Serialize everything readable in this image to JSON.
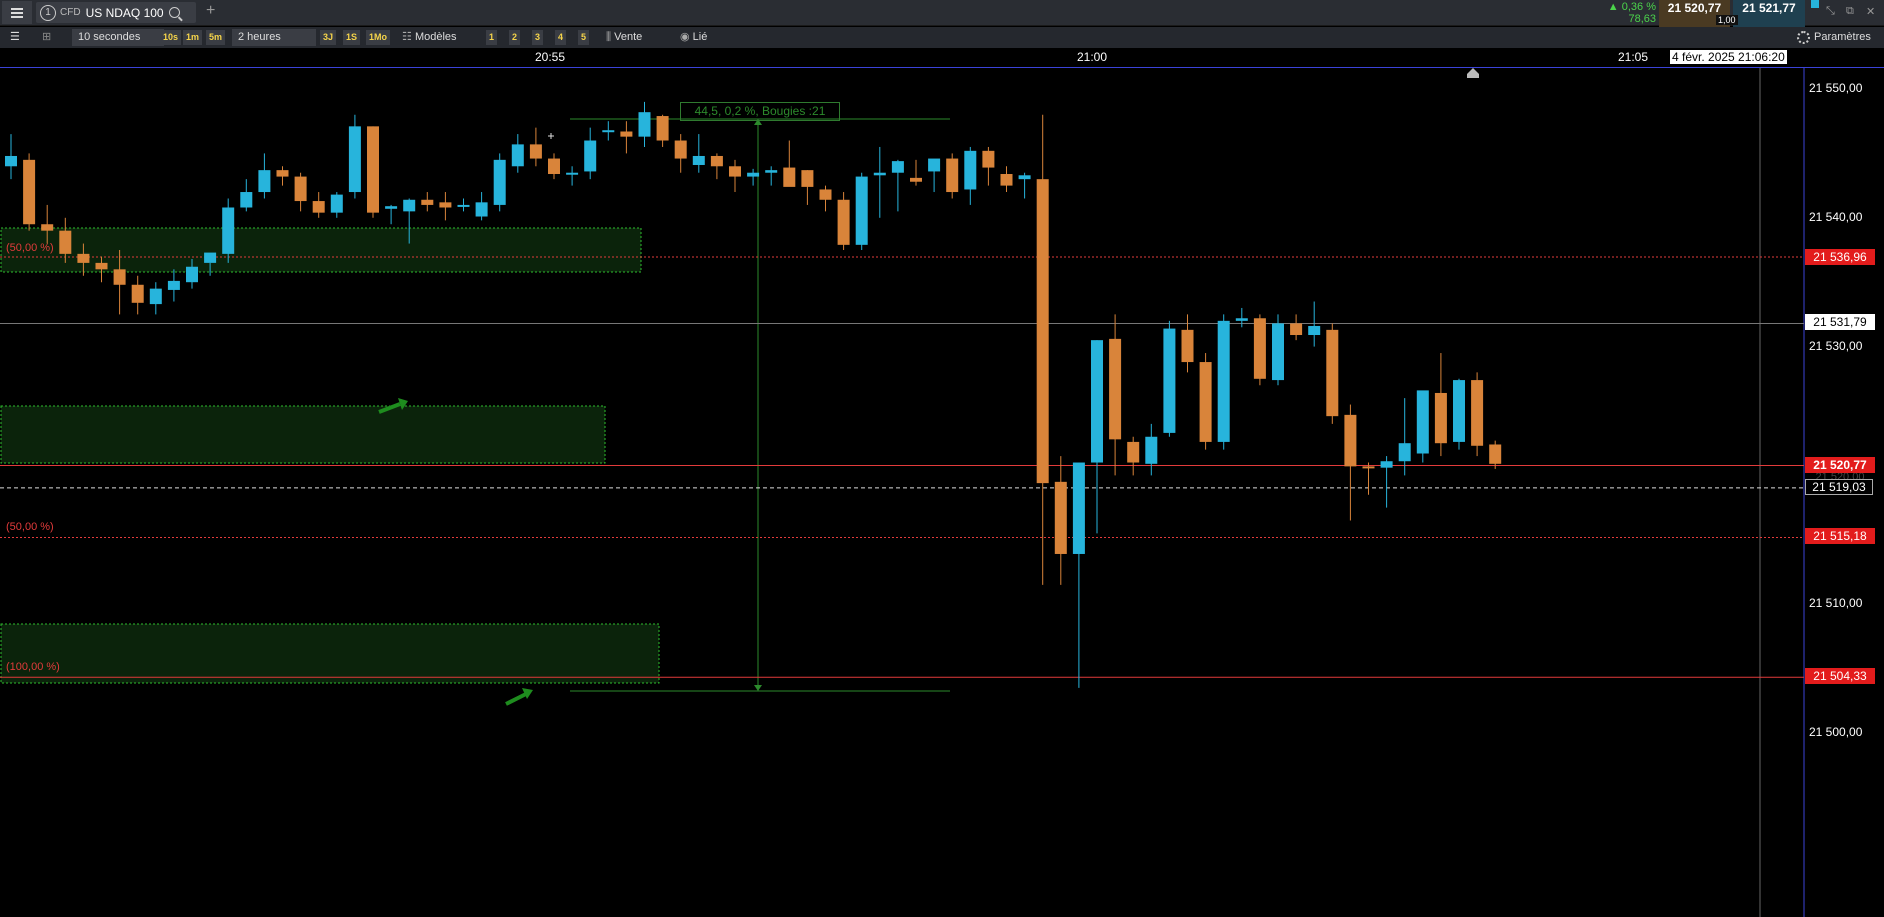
{
  "topbar": {
    "tab_number": "1",
    "tab_type": "CFD",
    "instrument": "US NDAQ 100",
    "add_tab": "+",
    "change_pct": "0,36 %",
    "change_pts": "78,63",
    "sell_price": "21 520,77",
    "buy_price": "21 521,77",
    "spread": "1,00"
  },
  "toolbar": {
    "interval": "10 secondes",
    "quick_intervals": [
      "10s",
      "1m",
      "5m"
    ],
    "range": "2 heures",
    "quick_ranges": [
      "3J",
      "1S",
      "1Mo"
    ],
    "templates_label": "Modèles",
    "template_slots": [
      "1",
      "2",
      "3",
      "4",
      "5"
    ],
    "price_side_label": "Vente",
    "link_label": "Lié",
    "settings_label": "Paramètres"
  },
  "time_axis": {
    "labels": [
      "20:55",
      "21:00",
      "21:05"
    ],
    "cursor_time": "4 févr. 2025 21:06:20"
  },
  "price_axis": {
    "labels": [
      "21 550,00",
      "21 540,00",
      "21 530,00",
      "21 510,00",
      "21 500,00"
    ],
    "tags": {
      "fib_top": "21 536,96",
      "crosshair": "21 531,79",
      "current": "21 520,77",
      "current_hidden": "21 520,00",
      "dashed": "21 519,03",
      "fib_mid": "21 515,18",
      "fib_low": "21 504,33"
    }
  },
  "annotations": {
    "fib_top_label": "(50,00 %)",
    "fib_mid_label": "(50,00 %)",
    "fib_low_label": "(100,00 %)",
    "measure_label": "44,5, 0,2 %, Bougies :21"
  },
  "colors": {
    "bull": "#27b4dc",
    "bear": "#d9843a",
    "fib_line": "#e23b3b",
    "zone_border": "#2ebd2e",
    "zone_fill": "#0b230b",
    "arrow": "#1e8c1e",
    "axis_line": "#3b43d9"
  },
  "chart_data": {
    "type": "candlestick",
    "instrument": "US NDAQ 100",
    "interval": "10 secondes",
    "price_unit": "index points",
    "ylim": [
      21496,
      21557
    ],
    "time_ticks": [
      "20:55",
      "21:00",
      "21:05"
    ],
    "candles": [
      {
        "o": 21544.0,
        "h": 21546.5,
        "l": 21543.0,
        "c": 21544.8
      },
      {
        "o": 21544.5,
        "h": 21545.0,
        "l": 21539.0,
        "c": 21539.5
      },
      {
        "o": 21539.5,
        "h": 21541.0,
        "l": 21538.0,
        "c": 21539.0
      },
      {
        "o": 21539.0,
        "h": 21540.0,
        "l": 21536.5,
        "c": 21537.2
      },
      {
        "o": 21537.2,
        "h": 21538.0,
        "l": 21535.5,
        "c": 21536.5
      },
      {
        "o": 21536.5,
        "h": 21537.0,
        "l": 21535.0,
        "c": 21536.0
      },
      {
        "o": 21536.0,
        "h": 21537.5,
        "l": 21532.5,
        "c": 21534.8
      },
      {
        "o": 21534.8,
        "h": 21535.5,
        "l": 21532.5,
        "c": 21533.4
      },
      {
        "o": 21533.3,
        "h": 21535.0,
        "l": 21532.5,
        "c": 21534.5
      },
      {
        "o": 21534.4,
        "h": 21536.0,
        "l": 21533.5,
        "c": 21535.1
      },
      {
        "o": 21535.0,
        "h": 21536.8,
        "l": 21534.5,
        "c": 21536.2
      },
      {
        "o": 21536.5,
        "h": 21536.5,
        "l": 21535.5,
        "c": 21537.3
      },
      {
        "o": 21537.2,
        "h": 21541.5,
        "l": 21536.5,
        "c": 21540.8
      },
      {
        "o": 21540.8,
        "h": 21543.0,
        "l": 21540.5,
        "c": 21542.0
      },
      {
        "o": 21542.0,
        "h": 21545.0,
        "l": 21541.5,
        "c": 21543.7
      },
      {
        "o": 21543.7,
        "h": 21544.0,
        "l": 21542.5,
        "c": 21543.2
      },
      {
        "o": 21543.2,
        "h": 21543.5,
        "l": 21540.5,
        "c": 21541.3
      },
      {
        "o": 21541.3,
        "h": 21542.0,
        "l": 21540.0,
        "c": 21540.4
      },
      {
        "o": 21540.4,
        "h": 21542.0,
        "l": 21540.0,
        "c": 21541.8
      },
      {
        "o": 21542.0,
        "h": 21548.0,
        "l": 21541.5,
        "c": 21547.1
      },
      {
        "o": 21547.1,
        "h": 21547.1,
        "l": 21540.0,
        "c": 21540.4
      },
      {
        "o": 21540.7,
        "h": 21541.0,
        "l": 21539.5,
        "c": 21540.9
      },
      {
        "o": 21540.5,
        "h": 21541.5,
        "l": 21538.0,
        "c": 21541.4
      },
      {
        "o": 21541.4,
        "h": 21542.0,
        "l": 21540.5,
        "c": 21541.0
      },
      {
        "o": 21541.2,
        "h": 21542.0,
        "l": 21539.8,
        "c": 21540.8
      },
      {
        "o": 21540.9,
        "h": 21541.5,
        "l": 21540.5,
        "c": 21541.0
      },
      {
        "o": 21540.1,
        "h": 21542.0,
        "l": 21539.8,
        "c": 21541.2
      },
      {
        "o": 21541.0,
        "h": 21545.0,
        "l": 21540.5,
        "c": 21544.5
      },
      {
        "o": 21544.0,
        "h": 21546.5,
        "l": 21543.5,
        "c": 21545.7
      },
      {
        "o": 21545.7,
        "h": 21547.0,
        "l": 21544.0,
        "c": 21544.6
      },
      {
        "o": 21544.6,
        "h": 21545.0,
        "l": 21543.0,
        "c": 21543.4
      },
      {
        "o": 21543.4,
        "h": 21544.0,
        "l": 21542.5,
        "c": 21543.5
      },
      {
        "o": 21543.6,
        "h": 21547.0,
        "l": 21543.0,
        "c": 21546.0
      },
      {
        "o": 21546.7,
        "h": 21547.5,
        "l": 21546.0,
        "c": 21546.8
      },
      {
        "o": 21546.7,
        "h": 21547.5,
        "l": 21545.0,
        "c": 21546.3
      },
      {
        "o": 21546.3,
        "h": 21549.0,
        "l": 21545.5,
        "c": 21548.2
      },
      {
        "o": 21547.9,
        "h": 21548.0,
        "l": 21545.5,
        "c": 21546.0
      },
      {
        "o": 21546.0,
        "h": 21546.5,
        "l": 21543.5,
        "c": 21544.6
      },
      {
        "o": 21544.1,
        "h": 21546.5,
        "l": 21543.5,
        "c": 21544.8
      },
      {
        "o": 21544.8,
        "h": 21545.0,
        "l": 21543.0,
        "c": 21544.0
      },
      {
        "o": 21544.0,
        "h": 21544.5,
        "l": 21542.0,
        "c": 21543.2
      },
      {
        "o": 21543.2,
        "h": 21543.8,
        "l": 21542.5,
        "c": 21543.5
      },
      {
        "o": 21543.5,
        "h": 21544.0,
        "l": 21542.5,
        "c": 21543.7
      },
      {
        "o": 21543.9,
        "h": 21546.0,
        "l": 21543.0,
        "c": 21542.4
      },
      {
        "o": 21543.7,
        "h": 21543.7,
        "l": 21541.0,
        "c": 21542.4
      },
      {
        "o": 21542.2,
        "h": 21542.5,
        "l": 21540.5,
        "c": 21541.4
      },
      {
        "o": 21541.4,
        "h": 21542.0,
        "l": 21537.5,
        "c": 21537.9
      },
      {
        "o": 21537.9,
        "h": 21543.5,
        "l": 21537.5,
        "c": 21543.2
      },
      {
        "o": 21543.3,
        "h": 21545.5,
        "l": 21540.0,
        "c": 21543.5
      },
      {
        "o": 21543.5,
        "h": 21544.5,
        "l": 21540.5,
        "c": 21544.4
      },
      {
        "o": 21543.1,
        "h": 21544.5,
        "l": 21542.5,
        "c": 21542.8
      },
      {
        "o": 21543.6,
        "h": 21544.5,
        "l": 21542.0,
        "c": 21544.6
      },
      {
        "o": 21544.6,
        "h": 21545.0,
        "l": 21541.5,
        "c": 21542.0
      },
      {
        "o": 21542.2,
        "h": 21545.5,
        "l": 21541.0,
        "c": 21545.2
      },
      {
        "o": 21545.2,
        "h": 21545.5,
        "l": 21542.5,
        "c": 21543.9
      },
      {
        "o": 21543.4,
        "h": 21544.0,
        "l": 21542.0,
        "c": 21542.5
      },
      {
        "o": 21543.0,
        "h": 21543.5,
        "l": 21541.5,
        "c": 21543.3
      },
      {
        "o": 21543.0,
        "h": 21548.0,
        "l": 21511.5,
        "c": 21519.4
      },
      {
        "o": 21519.5,
        "h": 21521.5,
        "l": 21511.5,
        "c": 21513.9
      },
      {
        "o": 21513.9,
        "h": 21521.0,
        "l": 21503.5,
        "c": 21521.0
      },
      {
        "o": 21521.0,
        "h": 21530.5,
        "l": 21515.5,
        "c": 21530.5
      },
      {
        "o": 21530.6,
        "h": 21532.5,
        "l": 21520.0,
        "c": 21522.8
      },
      {
        "o": 21522.6,
        "h": 21523.0,
        "l": 21520.0,
        "c": 21521.0
      },
      {
        "o": 21520.9,
        "h": 21524.0,
        "l": 21520.0,
        "c": 21523.0
      },
      {
        "o": 21523.3,
        "h": 21532.0,
        "l": 21523.0,
        "c": 21531.4
      },
      {
        "o": 21531.3,
        "h": 21532.5,
        "l": 21528.0,
        "c": 21528.8
      },
      {
        "o": 21528.8,
        "h": 21529.5,
        "l": 21522.0,
        "c": 21522.6
      },
      {
        "o": 21522.6,
        "h": 21532.5,
        "l": 21522.0,
        "c": 21532.0
      },
      {
        "o": 21532.0,
        "h": 21533.0,
        "l": 21531.5,
        "c": 21532.2
      },
      {
        "o": 21532.2,
        "h": 21532.5,
        "l": 21527.0,
        "c": 21527.5
      },
      {
        "o": 21527.4,
        "h": 21532.5,
        "l": 21527.0,
        "c": 21531.8
      },
      {
        "o": 21531.8,
        "h": 21532.5,
        "l": 21530.5,
        "c": 21530.9
      },
      {
        "o": 21530.9,
        "h": 21533.5,
        "l": 21530.0,
        "c": 21531.6
      },
      {
        "o": 21531.3,
        "h": 21531.8,
        "l": 21524.0,
        "c": 21524.6
      },
      {
        "o": 21524.7,
        "h": 21525.5,
        "l": 21516.5,
        "c": 21520.7
      },
      {
        "o": 21520.7,
        "h": 21521.0,
        "l": 21518.5,
        "c": 21520.6
      },
      {
        "o": 21520.6,
        "h": 21521.5,
        "l": 21517.5,
        "c": 21521.1
      },
      {
        "o": 21521.1,
        "h": 21526.0,
        "l": 21520.0,
        "c": 21522.5
      },
      {
        "o": 21521.7,
        "h": 21526.5,
        "l": 21521.0,
        "c": 21526.6
      },
      {
        "o": 21526.4,
        "h": 21529.5,
        "l": 21521.5,
        "c": 21522.5
      },
      {
        "o": 21522.6,
        "h": 21527.5,
        "l": 21522.0,
        "c": 21527.4
      },
      {
        "o": 21527.4,
        "h": 21528.0,
        "l": 21521.5,
        "c": 21522.3
      },
      {
        "o": 21522.4,
        "h": 21522.7,
        "l": 21520.5,
        "c": 21520.9
      }
    ],
    "levels": {
      "fib_top": 21536.96,
      "crosshair": 21531.79,
      "current": 21520.77,
      "dashed": 21519.03,
      "fib_mid": 21515.18,
      "fib_low": 21504.33
    }
  }
}
